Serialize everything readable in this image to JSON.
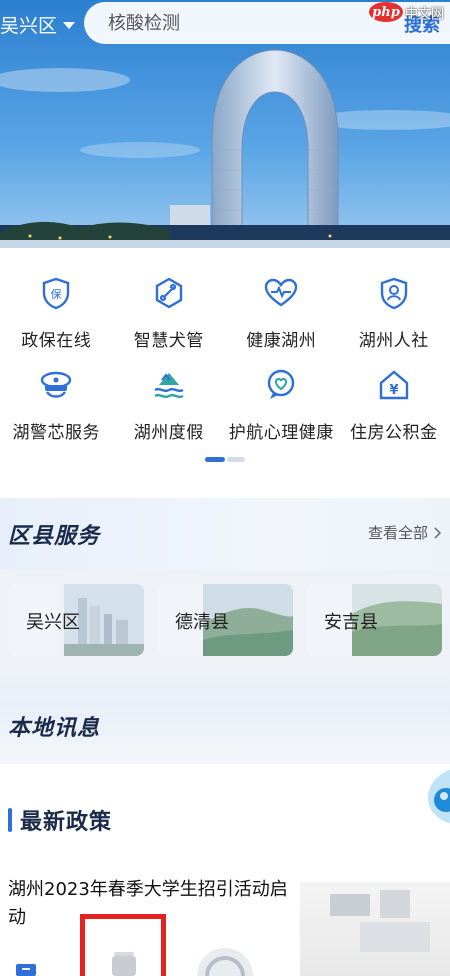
{
  "header": {
    "location": "吴兴区",
    "search_placeholder": "核酸检测",
    "search_button": "搜索",
    "watermark_php": "php",
    "watermark_site": "中文网"
  },
  "services": [
    {
      "label": "政保在线",
      "icon": "shield-bao-icon"
    },
    {
      "label": "智慧犬管",
      "icon": "dog-bone-icon"
    },
    {
      "label": "健康湖州",
      "icon": "heart-pulse-icon"
    },
    {
      "label": "湖州人社",
      "icon": "person-shield-icon"
    },
    {
      "label": "湖警芯服务",
      "icon": "police-cap-icon"
    },
    {
      "label": "湖州度假",
      "icon": "resort-icon"
    },
    {
      "label": "护航心理健康",
      "icon": "heart-bubble-icon"
    },
    {
      "label": "住房公积金",
      "icon": "house-yuan-icon"
    }
  ],
  "district": {
    "title": "区县服务",
    "view_all": "查看全部",
    "cards": [
      {
        "name": "吴兴区"
      },
      {
        "name": "德清县"
      },
      {
        "name": "安吉县"
      }
    ]
  },
  "local_news": {
    "title": "本地讯息"
  },
  "policy": {
    "title": "最新政策",
    "headline": "湖州2023年春季大学生招引活动启动"
  },
  "colors": {
    "accent": "#2f6fd8",
    "highlight_box": "#e3231f"
  }
}
